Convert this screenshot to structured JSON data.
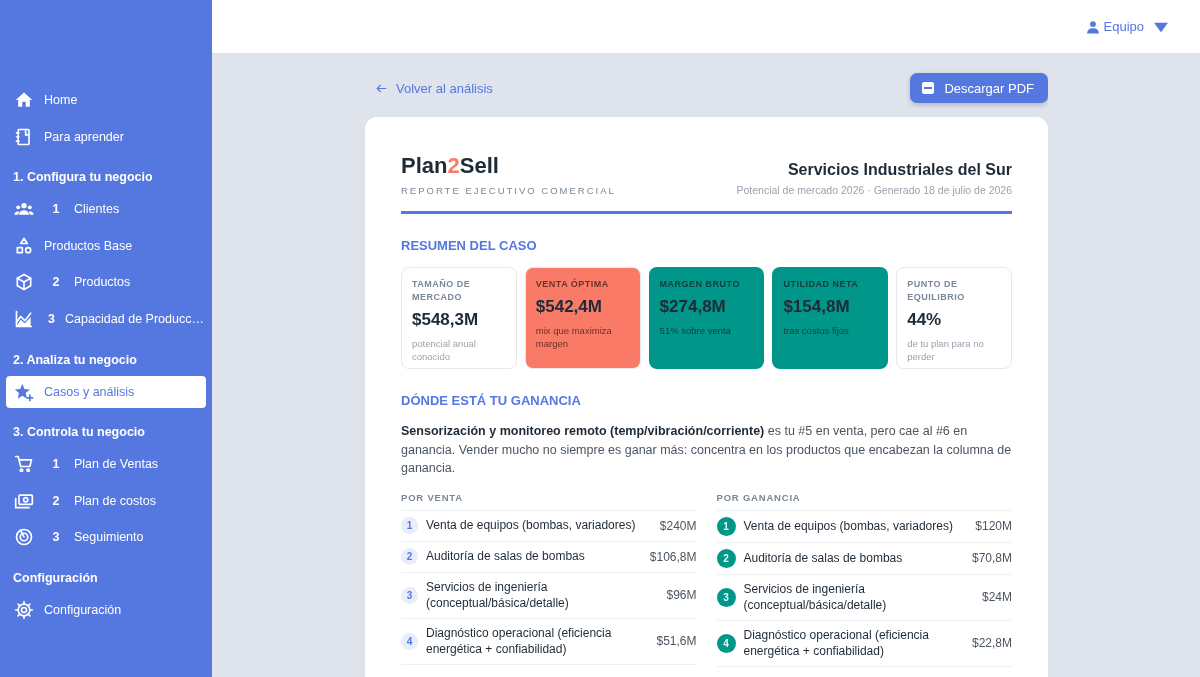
{
  "sidebar": {
    "groups": [
      {
        "items": [
          {
            "label": "Home",
            "selected": false
          },
          {
            "label": "Para aprender",
            "selected": false
          }
        ]
      },
      {
        "heading": "1. Configura tu negocio",
        "items": [
          {
            "number": "1",
            "label": "Clientes",
            "selected": false
          },
          {
            "label": "Productos Base",
            "selected": false
          },
          {
            "number": "2",
            "label": "Productos",
            "selected": false
          },
          {
            "number": "3",
            "label": "Capacidad de Producc…",
            "selected": false
          }
        ]
      },
      {
        "heading": "2. Analiza tu negocio",
        "items": [
          {
            "label": "Casos y análisis",
            "selected": true
          }
        ]
      },
      {
        "heading": "3. Controla tu negocio",
        "items": [
          {
            "number": "1",
            "label": "Plan de Ventas",
            "selected": false
          },
          {
            "number": "2",
            "label": "Plan de costos",
            "selected": false
          },
          {
            "number": "3",
            "label": "Seguimiento",
            "selected": false
          }
        ]
      },
      {
        "heading": "Configuración",
        "items": [
          {
            "label": "Configuración",
            "selected": false
          }
        ]
      }
    ]
  },
  "topbar": {
    "user": "Equipo"
  },
  "toolbar": {
    "back_link": "Volver al análisis",
    "download_button": "Descargar PDF"
  },
  "report": {
    "logo": {
      "before": "Plan",
      "accent": "2",
      "after": "Sell"
    },
    "subtitle": "REPORTE EJECUTIVO COMERCIAL",
    "company": "Servicios Industriales del Sur",
    "meta": "Potencial de mercado 2026 · Generado 18 de julio de 2026",
    "summary": {
      "title": "RESUMEN DEL CASO",
      "cards": [
        {
          "label": "TAMAÑO DE MERCADO",
          "value": "$548,3M",
          "note": "potencial anual conocido",
          "color": "#ffffff"
        },
        {
          "label": "VENTA ÓPTIMA",
          "value": "$542,4M",
          "note": "mix que maximiza margen",
          "color": "#fa7a68"
        },
        {
          "label": "MARGEN BRUTO",
          "value": "$274,8M",
          "note": "51% sobre venta",
          "color": "#00978a"
        },
        {
          "label": "UTILIDAD NETA",
          "value": "$154,8M",
          "note": "tras costos fijos",
          "color": "#00978a"
        },
        {
          "label": "PUNTO DE EQUILIBRIO",
          "value": "44%",
          "note": "de tu plan para no perder",
          "color": "#ffffff"
        }
      ]
    },
    "profit": {
      "title": "DÓNDE ESTÁ TU GANANCIA",
      "text": "**Sensorización y monitoreo remoto (temp/vibración/corriente)** es tu #5 en venta, pero cae al #6 en ganancia. Vender mucho no siempre es ganar más: concentra en los productos que encabezan la columna de ganancia.",
      "columns": [
        {
          "heading": "POR VENTA",
          "kind": "outline",
          "rows": [
            {
              "rank": "1",
              "name": "Venta de equipos (bombas, variadores)",
              "value": "$240M"
            },
            {
              "rank": "2",
              "name": "Auditoría de salas de bombas",
              "value": "$106,8M"
            },
            {
              "rank": "3",
              "name": "Servicios de ingeniería (conceptual/básica/detalle)",
              "value": "$96M"
            },
            {
              "rank": "4",
              "name": "Diagnóstico operacional (eficiencia energética + confiabilidad)",
              "value": "$51,6M"
            }
          ]
        },
        {
          "heading": "POR GANANCIA",
          "kind": "filled",
          "rows": [
            {
              "rank": "1",
              "name": "Venta de equipos (bombas, variadores)",
              "value": "$120M"
            },
            {
              "rank": "2",
              "name": "Auditoría de salas de bombas",
              "value": "$70,8M"
            },
            {
              "rank": "3",
              "name": "Servicios de ingeniería (conceptual/básica/detalle)",
              "value": "$24M"
            },
            {
              "rank": "4",
              "name": "Diagnóstico operacional (eficiencia energética + confiabilidad)",
              "value": "$22,8M"
            }
          ]
        }
      ]
    }
  }
}
